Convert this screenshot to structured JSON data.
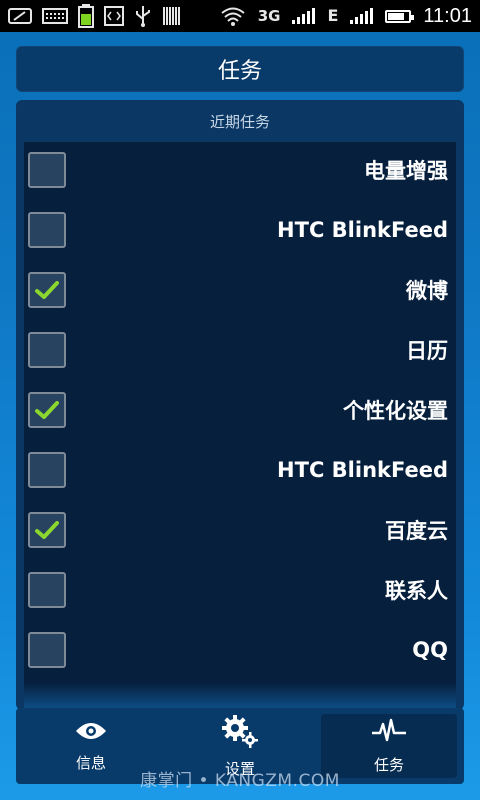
{
  "status_bar": {
    "time": "11:01",
    "network_label": "3G",
    "edge_label": "E",
    "icons": [
      "screen-icon",
      "keyboard-icon",
      "battery-charging-icon",
      "code-icon",
      "usb-icon",
      "barcode-icon",
      "wifi-icon",
      "signal-icon",
      "battery-icon"
    ],
    "battery_level": 0.7
  },
  "header": {
    "title": "任务"
  },
  "section": {
    "label": "近期任务",
    "items": [
      {
        "label": "电量增强",
        "checked": false
      },
      {
        "label": "HTC BlinkFeed",
        "checked": false
      },
      {
        "label": "微博",
        "checked": true
      },
      {
        "label": "日历",
        "checked": false
      },
      {
        "label": "个性化设置",
        "checked": true
      },
      {
        "label": "HTC BlinkFeed",
        "checked": false
      },
      {
        "label": "百度云",
        "checked": true
      },
      {
        "label": "联系人",
        "checked": false
      },
      {
        "label": "QQ",
        "checked": false
      }
    ]
  },
  "nav": {
    "items": [
      {
        "label": "信息",
        "icon": "eye-icon",
        "active": false
      },
      {
        "label": "设置",
        "icon": "gears-icon",
        "active": false
      },
      {
        "label": "任务",
        "icon": "pulse-icon",
        "active": true
      }
    ]
  },
  "watermark": "康掌门 • KANGZM.COM",
  "colors": {
    "background": "#0f78c4",
    "panel": "#0a3764",
    "list": "#061f3d",
    "check": "#8bd630"
  }
}
